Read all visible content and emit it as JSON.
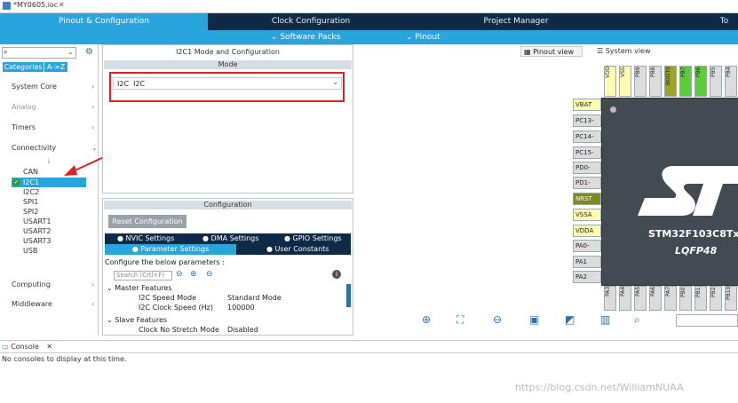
{
  "window": {
    "title": "*MY0605.ioc"
  },
  "tabs": [
    {
      "label": "Pinout & Configuration",
      "active": true
    },
    {
      "label": "Clock Configuration",
      "active": false
    },
    {
      "label": "Project Manager",
      "active": false
    },
    {
      "label": "To",
      "active": false
    }
  ],
  "subtabs": {
    "software_packs": "Software Packs",
    "pinout": "Pinout"
  },
  "left": {
    "search_value": "",
    "tab_categories": "Categories",
    "tab_az": "A->Z",
    "categories": [
      {
        "label": "System Core"
      },
      {
        "label": "Analog"
      },
      {
        "label": "Timers"
      },
      {
        "label": "Connectivity"
      }
    ],
    "connectivity_items": [
      "CAN",
      "I2C1",
      "I2C2",
      "SPI1",
      "SPI2",
      "USART1",
      "USART2",
      "USART3",
      "USB"
    ],
    "selected_item": "I2C1",
    "bottom_categories": [
      {
        "label": "Computing"
      },
      {
        "label": "Middleware"
      }
    ]
  },
  "mode_panel": {
    "title": "I2C1 Mode and Configuration",
    "mode_header": "Mode",
    "i2c_label": "I2C",
    "i2c_value": "I2C"
  },
  "config_panel": {
    "header": "Configuration",
    "reset_button": "Reset Configuration",
    "tabs_row1": [
      "NVIC Settings",
      "DMA Settings",
      "GPIO Settings"
    ],
    "tabs_row2": [
      "Parameter Settings",
      "User Constants"
    ],
    "intro": "Configure the below parameters :",
    "search_placeholder": "Search (Crtl+F)",
    "sections": [
      {
        "title": "Master Features",
        "rows": [
          {
            "name": "I2C Speed Mode",
            "value": "Standard Mode"
          },
          {
            "name": "I2C Clock Speed (Hz)",
            "value": "100000"
          }
        ]
      },
      {
        "title": "Slave Features",
        "rows": [
          {
            "name": "Clock No Stretch Mode",
            "value": "Disabled"
          }
        ]
      }
    ]
  },
  "pinout": {
    "view_pinout": "Pinout view",
    "view_system": "System view",
    "top_pins": [
      "VDD",
      "VSS",
      "PB9",
      "PB8",
      "BOOT0",
      "PB7",
      "PB6",
      "PB5",
      "PB4"
    ],
    "left_pins": [
      "VBAT",
      "PC13-",
      "PC14-",
      "PC15-",
      "PD0-",
      "PD1-",
      "NRST",
      "VSSA",
      "VDDA",
      "PA0-",
      "PA1",
      "PA2"
    ],
    "bottom_pins": [
      "PA3",
      "PA4",
      "PA5",
      "PA6",
      "PA7",
      "PB0",
      "PB1",
      "PB2",
      "PB10"
    ],
    "chip_name": "STM32F103C8Tx",
    "chip_package": "LQFP48",
    "top_colors": {
      "4": "#9aa42a",
      "5": "#5ccc3a",
      "6": "#5ccc3a"
    }
  },
  "console": {
    "tab_label": "Console",
    "message": "No consoles to display at this time."
  },
  "watermark": "https://blog.csdn.net/WilliamNUAA"
}
